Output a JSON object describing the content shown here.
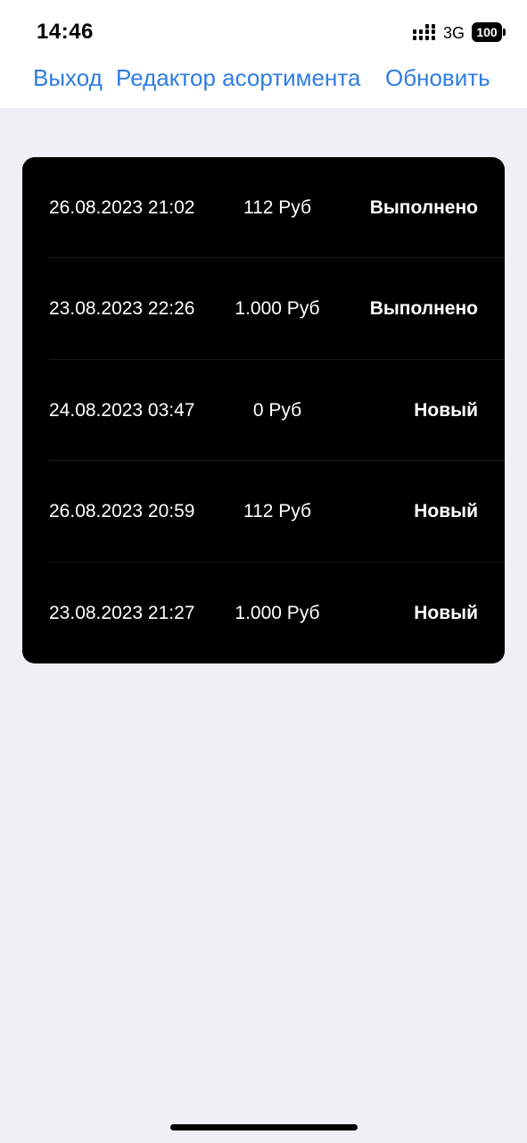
{
  "status_bar": {
    "time": "14:46",
    "network": "3G",
    "battery": "100",
    "icons": [
      "signal-icon",
      "battery-icon"
    ]
  },
  "nav": {
    "exit_label": "Выход",
    "editor_label": "Редактор асортимента",
    "refresh_label": "Обновить"
  },
  "orders": [
    {
      "date": "26.08.2023 21:02",
      "amount": "112 Руб",
      "status": "Выполнено"
    },
    {
      "date": "23.08.2023 22:26",
      "amount": "1.000 Руб",
      "status": "Выполнено"
    },
    {
      "date": "24.08.2023 03:47",
      "amount": "0 Руб",
      "status": "Новый"
    },
    {
      "date": "26.08.2023 20:59",
      "amount": "112 Руб",
      "status": "Новый"
    },
    {
      "date": "23.08.2023 21:27",
      "amount": "1.000 Руб",
      "status": "Новый"
    }
  ],
  "colors": {
    "accent": "#2f7de1",
    "background": "#efeff4",
    "card": "#000000",
    "card_text": "#ffffff"
  }
}
